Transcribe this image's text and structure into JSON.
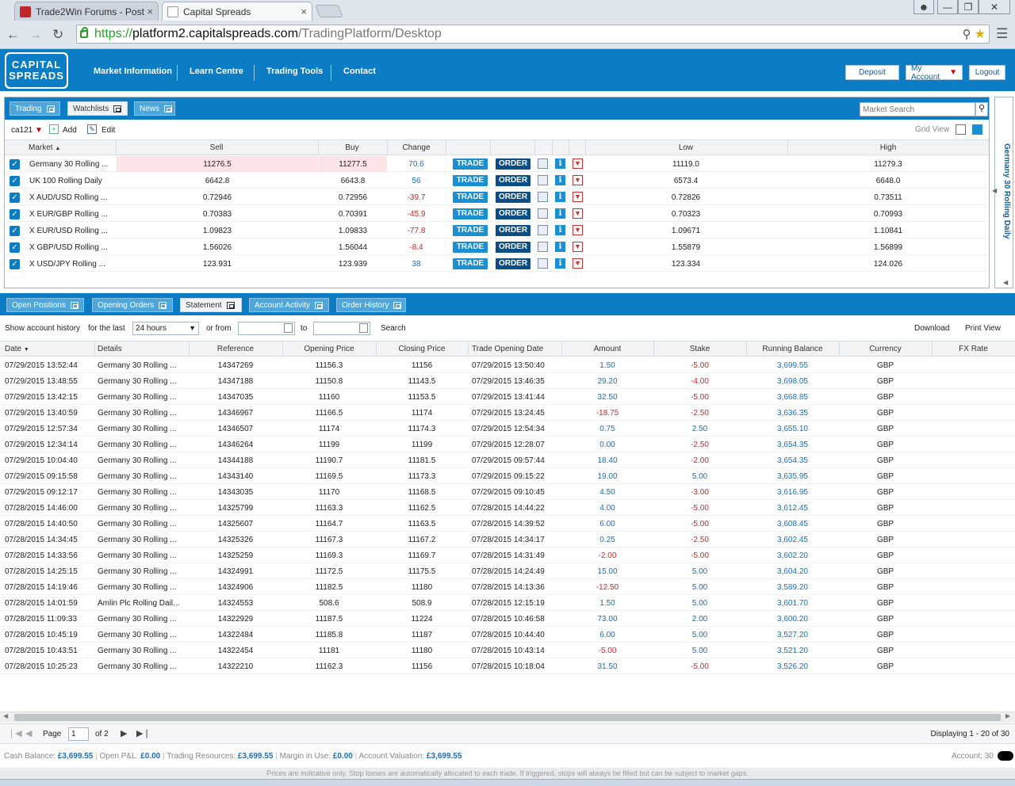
{
  "browser": {
    "tabs": [
      {
        "title": "Trade2Win Forums - Post",
        "close": "×"
      },
      {
        "title": "Capital Spreads",
        "close": "×"
      }
    ],
    "url_scheme": "https://",
    "url_host": "platform2.capitalspreads.com",
    "url_path": "/TradingPlatform/Desktop"
  },
  "site": {
    "logo_line1": "CAPITAL",
    "logo_line2": "SPREADS",
    "nav": [
      "Market Information",
      "Learn Centre",
      "Trading Tools",
      "Contact"
    ],
    "deposit": "Deposit",
    "my_account": "My Account",
    "logout": "Logout"
  },
  "watch": {
    "tabs": [
      "Trading",
      "Watchlists",
      "News"
    ],
    "search_placeholder": "Market Search",
    "account_label": "ca121",
    "add": "Add",
    "edit": "Edit",
    "grid_view": "Grid View",
    "side_title": "Germany 30 Rolling Daily",
    "columns": [
      "Market",
      "Sell",
      "Buy",
      "Change",
      "Low",
      "High"
    ],
    "trade_label": "TRADE",
    "order_label": "ORDER",
    "rows": [
      {
        "market": "Germany 30 Rolling ...",
        "sell": "11276.5",
        "buy": "11277.5",
        "change": "70.6",
        "low": "11119.0",
        "high": "11279.3",
        "dir": "pos"
      },
      {
        "market": "UK 100 Rolling Daily",
        "sell": "6642.8",
        "buy": "6643.8",
        "change": "56",
        "low": "6573.4",
        "high": "6648.0",
        "dir": "pos"
      },
      {
        "market": "X AUD/USD Rolling ...",
        "sell": "0.72946",
        "buy": "0.72956",
        "change": "-39.7",
        "low": "0.72826",
        "high": "0.73511",
        "dir": "neg"
      },
      {
        "market": "X EUR/GBP Rolling ...",
        "sell": "0.70383",
        "buy": "0.70391",
        "change": "-45.9",
        "low": "0.70323",
        "high": "0.70993",
        "dir": "neg"
      },
      {
        "market": "X EUR/USD Rolling ...",
        "sell": "1.09823",
        "buy": "1.09833",
        "change": "-77.8",
        "low": "1.09671",
        "high": "1.10841",
        "dir": "neg"
      },
      {
        "market": "X GBP/USD Rolling ...",
        "sell": "1.56026",
        "buy": "1.56044",
        "change": "-8.4",
        "low": "1.55879",
        "high": "1.56899",
        "dir": "neg"
      },
      {
        "market": "X USD/JPY Rolling ...",
        "sell": "123.931",
        "buy": "123.939",
        "change": "38",
        "low": "123.334",
        "high": "124.026",
        "dir": "pos"
      }
    ]
  },
  "lower": {
    "tabs": [
      "Open Positions",
      "Opening Orders",
      "Statement",
      "Account Activity",
      "Order History"
    ],
    "filter_label": "Show account history",
    "for_the_last": "for the last",
    "period": "24 hours",
    "or_from": "or from",
    "to": "to",
    "search": "Search",
    "download": "Download",
    "print_view": "Print View",
    "columns": [
      "Date",
      "Details",
      "Reference",
      "Opening Price",
      "Closing Price",
      "Trade Opening Date",
      "Amount",
      "Stake",
      "Running Balance",
      "Currency",
      "FX Rate"
    ],
    "rows": [
      [
        "07/29/2015 13:52:44",
        "Germany 30 Rolling ...",
        "14347269",
        "11156.3",
        "11156",
        "07/29/2015 13:50:40",
        "1.50",
        "-5.00",
        "3,699.55",
        "GBP"
      ],
      [
        "07/29/2015 13:48:55",
        "Germany 30 Rolling ...",
        "14347188",
        "11150.8",
        "11143.5",
        "07/29/2015 13:46:35",
        "29.20",
        "-4.00",
        "3,698.05",
        "GBP"
      ],
      [
        "07/29/2015 13:42:15",
        "Germany 30 Rolling ...",
        "14347035",
        "11160",
        "11153.5",
        "07/29/2015 13:41:44",
        "32.50",
        "-5.00",
        "3,668.85",
        "GBP"
      ],
      [
        "07/29/2015 13:40:59",
        "Germany 30 Rolling ...",
        "14346967",
        "11166.5",
        "11174",
        "07/29/2015 13:24:45",
        "-18.75",
        "-2.50",
        "3,636.35",
        "GBP"
      ],
      [
        "07/29/2015 12:57:34",
        "Germany 30 Rolling ...",
        "14346507",
        "11174",
        "11174.3",
        "07/29/2015 12:54:34",
        "0.75",
        "2.50",
        "3,655.10",
        "GBP"
      ],
      [
        "07/29/2015 12:34:14",
        "Germany 30 Rolling ...",
        "14346264",
        "11199",
        "11199",
        "07/29/2015 12:28:07",
        "0.00",
        "-2.50",
        "3,654.35",
        "GBP"
      ],
      [
        "07/29/2015 10:04:40",
        "Germany 30 Rolling ...",
        "14344188",
        "11190.7",
        "11181.5",
        "07/29/2015 09:57:44",
        "18.40",
        "-2.00",
        "3,654.35",
        "GBP"
      ],
      [
        "07/29/2015 09:15:58",
        "Germany 30 Rolling ...",
        "14343140",
        "11169.5",
        "11173.3",
        "07/29/2015 09:15:22",
        "19.00",
        "5.00",
        "3,635.95",
        "GBP"
      ],
      [
        "07/29/2015 09:12:17",
        "Germany 30 Rolling ...",
        "14343035",
        "11170",
        "11168.5",
        "07/29/2015 09:10:45",
        "4.50",
        "-3.00",
        "3,616.95",
        "GBP"
      ],
      [
        "07/28/2015 14:46:00",
        "Germany 30 Rolling ...",
        "14325799",
        "11163.3",
        "11162.5",
        "07/28/2015 14:44:22",
        "4.00",
        "-5.00",
        "3,612.45",
        "GBP"
      ],
      [
        "07/28/2015 14:40:50",
        "Germany 30 Rolling ...",
        "14325607",
        "11164.7",
        "11163.5",
        "07/28/2015 14:39:52",
        "6.00",
        "-5.00",
        "3,608.45",
        "GBP"
      ],
      [
        "07/28/2015 14:34:45",
        "Germany 30 Rolling ...",
        "14325326",
        "11167.3",
        "11167.2",
        "07/28/2015 14:34:17",
        "0.25",
        "-2.50",
        "3,602.45",
        "GBP"
      ],
      [
        "07/28/2015 14:33:56",
        "Germany 30 Rolling ...",
        "14325259",
        "11169.3",
        "11169.7",
        "07/28/2015 14:31:49",
        "-2.00",
        "-5.00",
        "3,602.20",
        "GBP"
      ],
      [
        "07/28/2015 14:25:15",
        "Germany 30 Rolling ...",
        "14324991",
        "11172.5",
        "11175.5",
        "07/28/2015 14:24:49",
        "15.00",
        "5.00",
        "3,604.20",
        "GBP"
      ],
      [
        "07/28/2015 14:19:46",
        "Germany 30 Rolling ...",
        "14324906",
        "11182.5",
        "11180",
        "07/28/2015 14:13:36",
        "-12.50",
        "5.00",
        "3,589.20",
        "GBP"
      ],
      [
        "07/28/2015 14:01:59",
        "Amlin Plc Rolling Dail...",
        "14324553",
        "508.6",
        "508.9",
        "07/28/2015 12:15:19",
        "1.50",
        "5.00",
        "3,601.70",
        "GBP"
      ],
      [
        "07/28/2015 11:09:33",
        "Germany 30 Rolling ...",
        "14322929",
        "11187.5",
        "11224",
        "07/28/2015 10:46:58",
        "73.00",
        "2.00",
        "3,600.20",
        "GBP"
      ],
      [
        "07/28/2015 10:45:19",
        "Germany 30 Rolling ...",
        "14322484",
        "11185.8",
        "11187",
        "07/28/2015 10:44:40",
        "6.00",
        "5.00",
        "3,527.20",
        "GBP"
      ],
      [
        "07/28/2015 10:43:51",
        "Germany 30 Rolling ...",
        "14322454",
        "11181",
        "11180",
        "07/28/2015 10:43:14",
        "-5.00",
        "5.00",
        "3,521.20",
        "GBP"
      ],
      [
        "07/28/2015 10:25:23",
        "Germany 30 Rolling ...",
        "14322210",
        "11162.3",
        "11156",
        "07/28/2015 10:18:04",
        "31.50",
        "-5.00",
        "3,526.20",
        "GBP"
      ]
    ],
    "pager": {
      "page_label": "Page",
      "page": "1",
      "of": "of 2",
      "displaying": "Displaying 1 - 20 of 30"
    }
  },
  "status": {
    "cash_label": "Cash Balance:",
    "cash": "£3,699.55",
    "pl_label": "Open P&L:",
    "pl": "£0.00",
    "res_label": "Trading Resources:",
    "res": "£3,699.55",
    "margin_label": "Margin in Use:",
    "margin": "£0.00",
    "val_label": "Account Valuation:",
    "val": "£3,699.55",
    "account_label": "Account: 30",
    "disclaimer": "Prices are indicative only. Stop losses are automatically allocated to each trade. If triggered, stops will always be filled but can be subject to market gaps."
  },
  "colors": {
    "brand": "#0c7cc4",
    "positive": "#1a6fc2",
    "negative": "#d22222"
  }
}
